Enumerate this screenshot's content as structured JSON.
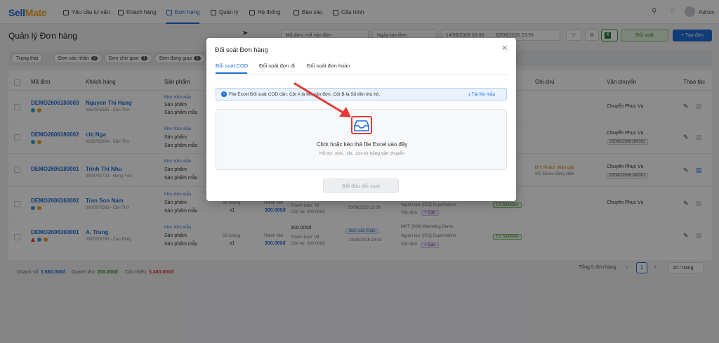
{
  "nav": {
    "logo_a": "Sell",
    "logo_b": "Mate",
    "items": [
      {
        "label": "Yêu cầu tư vấn"
      },
      {
        "label": "Khách hàng"
      },
      {
        "label": "Đơn hàng"
      },
      {
        "label": "Quản lý"
      },
      {
        "label": "Hệ thống"
      },
      {
        "label": "Báo cáo"
      },
      {
        "label": "Cấu hình"
      }
    ],
    "active_index": 2,
    "user": "Admin"
  },
  "page": {
    "title": "Quản lý Đơn hàng",
    "search_placeholder": "Mã đơn, mã vận đơn",
    "date_type": "Ngày tạo đơn",
    "date_from": "14/06/2026 00:00",
    "date_to": "20/06/2026 23:59",
    "reconcile_button": "Đối soát",
    "create_button": "+ Tạo đơn"
  },
  "filters": [
    {
      "label": "Trạng thái",
      "count": ""
    },
    {
      "label": "Đơn xác nhận",
      "count": "2"
    },
    {
      "label": "Đơn chờ giao",
      "count": "1"
    },
    {
      "label": "Đơn đang giao",
      "count": "1"
    }
  ],
  "table": {
    "headers": {
      "code": "Mã đơn",
      "customer": "Khách hàng",
      "product": "Sản phẩm",
      "note": "Ghi chú",
      "shipping": "Vận chuyển",
      "actions": "Thao tác"
    },
    "rows": [
      {
        "code": "DEMO2606180003",
        "customer": "Nguyen Thi Hang",
        "phone": "0967876565 - Cần Thơ",
        "warehouse": "Kho: Kho mẫu",
        "products": [
          "Sản phẩm",
          "Sản phẩm mẫu"
        ],
        "shipping": "Chuyển Phục Vụ",
        "tracking": ""
      },
      {
        "code": "DEMO2606180002",
        "customer": "chị Nga",
        "phone": "0956765654 - Cần Thơ",
        "warehouse": "Kho: Kho mẫu",
        "products": [
          "Sản phẩm",
          "Sản phẩm mẫu"
        ],
        "shipping": "Chuyển Phục Vụ",
        "tracking": "DEMO2606180002"
      },
      {
        "code": "DEMO2606180001",
        "customer": "Trinh Thi Nhu",
        "phone": "0978787723 - Hưng Yên",
        "warehouse": "Kho: Kho mẫu",
        "products": [
          "Sản phẩm",
          "Sản phẩm mẫu"
        ],
        "shipping": "Chuyển Phục Vụ",
        "tracking": "DEMO2606180001"
      },
      {
        "code": "DEMO2606160002",
        "customer": "Tran Son Nam",
        "phone": "0987876565 - Cần Thơ",
        "warehouse": "Kho: Kho mẫu",
        "products": [
          "Sản phẩm",
          "Sản phẩm mẫu"
        ],
        "shipping": "Chuyển Phục Vụ",
        "tracking": ""
      },
      {
        "code": "DEMO2606160001",
        "customer": "A. Trung",
        "phone": "0987676765 - Cao Bằng",
        "warehouse": "Kho: Kho mẫu",
        "products": [
          "Sản phẩm",
          "Sản phẩm mẫu"
        ],
        "shipping": "",
        "tracking": ""
      }
    ],
    "notes": {
      "row3_a": "ĐH: Khách nhận gấp",
      "row3_b": "VC: Được đồng kiểm"
    },
    "details": {
      "row4": {
        "qty_label": "Số lượng",
        "qty": "x1",
        "total_label": "Thành tiền",
        "total": "300.000đ",
        "paid": "Thanh toán: 0đ",
        "remain": "Còn nợ: 300.000đ",
        "date": "20/06/2026 13:09",
        "creator": "Người tạo: [001] SuperAdmin",
        "carrier": "Vận đơn:",
        "add": "+ Gán",
        "source": "Từ SellMate"
      },
      "row5": {
        "price": "300.000đ",
        "qty_label": "Số lượng",
        "qty": "x1",
        "total_label": "Thành tiền",
        "total": "300.000đ",
        "paid": "Thanh toán: 0đ",
        "remain": "Còn nợ: 300.000đ",
        "status": "Đơn xác nhận",
        "date": "16/06/2026 14:43",
        "mkt": "MKT: [006] Marketing Demo",
        "creator": "Người tạo: [001] SuperAdmin",
        "carrier": "Vận đơn:",
        "add": "+ Gán",
        "source": "Từ SellMate"
      }
    }
  },
  "footer": {
    "revenue_label": "Doanh số:",
    "revenue": "3.680.000đ",
    "income_label": "Doanh thu:",
    "income": "200.000đ",
    "due_label": "Còn thiếu:",
    "due": "3.480.000đ",
    "total_text": "Tổng 5 đơn hàng",
    "current_page": "1",
    "page_size": "20 / trang"
  },
  "modal": {
    "title": "Đối soát Đơn hàng",
    "tabs": [
      "Đối soát COD",
      "Đối soát đơn đi",
      "Đối soát đơn hoàn"
    ],
    "active_tab": 0,
    "info": "File Excel Đối soát COD cần: Cột A là Mã vận đơn, Cột B là Số tiền thu hộ.",
    "download_link": "Tải file mẫu",
    "drop_text": "Click hoặc kéo thả file Excel vào đây",
    "drop_subtext": "Hỗ trợ .xlsx, .xls, .csv từ hãng vận chuyển",
    "start_button": "Bắt đầu đối soát"
  },
  "colors": {
    "primary": "#1f6fd9",
    "accent": "#f5a623",
    "highlight": "#e53935",
    "success": "#3d8f2b"
  }
}
